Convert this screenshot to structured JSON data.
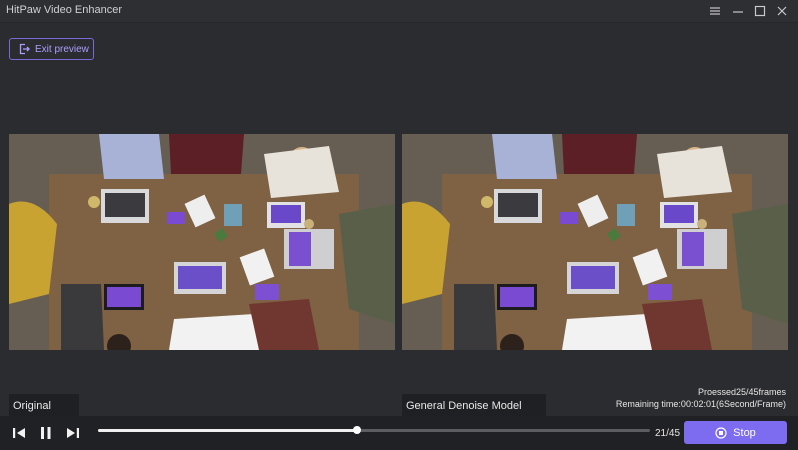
{
  "app": {
    "title": "HitPaw Video Enhancer"
  },
  "toolbar": {
    "exit_label": "Exit preview"
  },
  "preview": {
    "original_label": "Original",
    "model_label": "General Denoise Model"
  },
  "status": {
    "processed": "Proessed25/45frames",
    "remaining": "Remaining time:00:02:01(6Second/Frame)"
  },
  "playback": {
    "counter": "21/45",
    "progress": 0.47,
    "stop_label": "Stop"
  },
  "colors": {
    "accent": "#7d6cf0",
    "background": "#2b2c2f"
  },
  "icons": [
    "minimize-menu-icon",
    "minimize-icon",
    "maximize-icon",
    "close-icon",
    "exit-preview-icon",
    "prev-frame-icon",
    "pause-icon",
    "next-frame-icon",
    "stop-icon"
  ]
}
